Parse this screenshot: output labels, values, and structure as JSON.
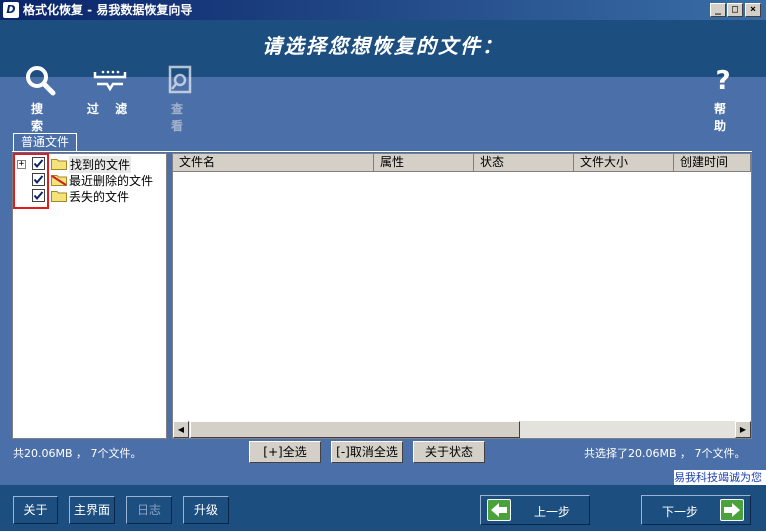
{
  "window": {
    "title": "格式化恢复 - 易我数据恢复向导",
    "app_icon": "D"
  },
  "header": {
    "prompt": "请选择您想恢复的文件："
  },
  "toolbar": {
    "search": "搜 索",
    "filter": "过 滤",
    "view": "查 看",
    "help": "帮 助"
  },
  "tab": {
    "label": "普通文件"
  },
  "tree": {
    "items": [
      {
        "label": "找到的文件",
        "checked": true
      },
      {
        "label": "最近删除的文件",
        "checked": true
      },
      {
        "label": "丢失的文件",
        "checked": true
      }
    ]
  },
  "list": {
    "columns": [
      "文件名",
      "属性",
      "状态",
      "文件大小",
      "创建时间"
    ]
  },
  "status": {
    "left": "共20.06MB ， 7个文件。",
    "right": "共选择了20.06MB ， 7个文件。"
  },
  "actions": {
    "select_all": "[+]全选",
    "deselect_all": "[-]取消全选",
    "about_status": "关于状态"
  },
  "slogan": "易我科技竭诚为您",
  "bottom": {
    "about": "关于",
    "main": "主界面",
    "log": "日志",
    "upgrade": "升级",
    "prev": "上一步",
    "next": "下一步"
  },
  "colors": {
    "header_bg": "#1d4e80",
    "body_bg": "#4b6fa8",
    "highlight_box": "#e21b1b",
    "nav_arrow": "#4aa23a"
  }
}
